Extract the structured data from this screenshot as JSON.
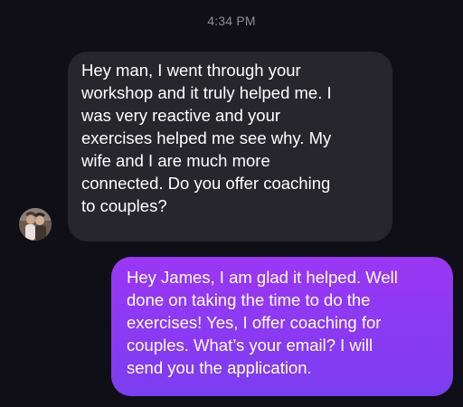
{
  "thread": {
    "timestamp": "4:34 PM",
    "messages": [
      {
        "direction": "incoming",
        "text": "Hey man, I went through your\nworkshop and it truly helped me. I\nwas very reactive and your\nexercises helped me see why. My\nwife and I are much more\nconnected. Do you offer coaching\nto couples?"
      },
      {
        "direction": "outgoing",
        "text": "Hey James, I am glad it helped. Well\ndone on taking the time to do the\nexercises! Yes, I offer coaching for\ncouples. What’s your email? I will\nsend you the application."
      }
    ],
    "avatar_icon": "profile-photo-avatar"
  },
  "colors": {
    "background": "#0f0f15",
    "incoming_bubble": "#26262c",
    "outgoing_bubble_top": "#9a37f5",
    "outgoing_bubble_bottom": "#7a3ef0",
    "timestamp_text": "#8e8e93",
    "message_text": "#ffffff"
  }
}
